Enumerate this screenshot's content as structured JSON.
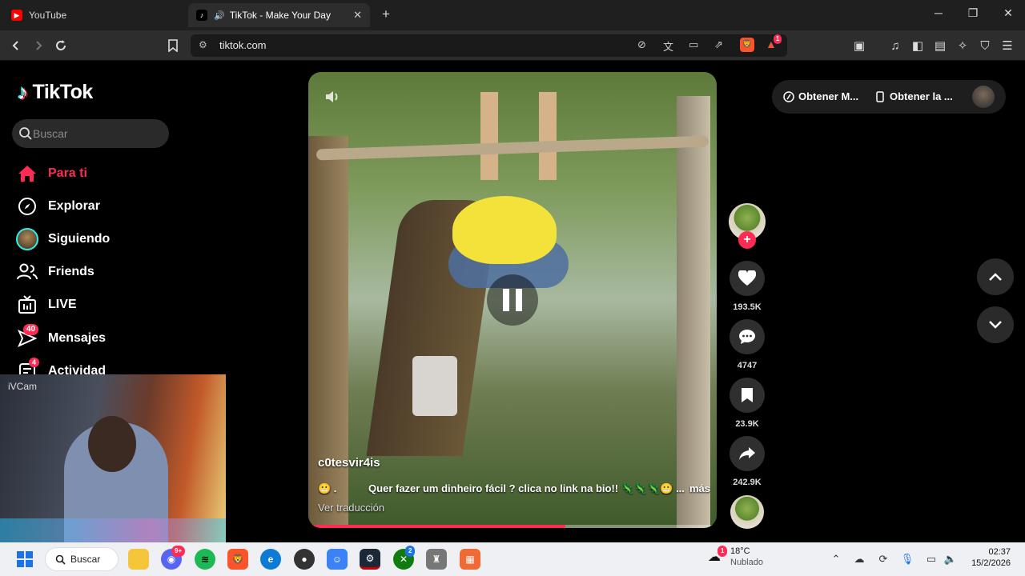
{
  "browser": {
    "tabs": [
      {
        "title": "YouTube",
        "active": false
      },
      {
        "title": "TikTok - Make Your Day",
        "active": true
      }
    ],
    "new_tab": "+",
    "url": "tiktok.com",
    "brave_badge": "1"
  },
  "sidebar": {
    "logo": "TikTok",
    "search_placeholder": "Buscar",
    "nav": [
      {
        "label": "Para ti",
        "icon": "home-icon",
        "active": true
      },
      {
        "label": "Explorar",
        "icon": "compass-icon"
      },
      {
        "label": "Siguiendo",
        "icon": "avatar-icon"
      },
      {
        "label": "Friends",
        "icon": "friends-icon"
      },
      {
        "label": "LIVE",
        "icon": "live-tv-icon"
      },
      {
        "label": "Mensajes",
        "icon": "send-icon",
        "badge": "40"
      },
      {
        "label": "Actividad",
        "icon": "activity-icon",
        "badge": "4"
      }
    ]
  },
  "webcam": {
    "label": "iVCam"
  },
  "video": {
    "author": "c0tesvir4is",
    "caption": "Quer fazer um dinheiro fácil ?  clica no link na bio!! 🦎🦎🦎😬 ...",
    "caption_prefix": "😬 .",
    "more": "más",
    "translate": "Ver traducción",
    "progress": 0.63
  },
  "actions": {
    "likes": "193.5K",
    "comments": "4747",
    "saves": "23.9K",
    "shares": "242.9K"
  },
  "top_pills": {
    "get_more": "Obtener M...",
    "get_app": "Obtener la ..."
  },
  "taskbar": {
    "search_label": "Buscar",
    "discord_badge": "9+",
    "xbox_badge": "2",
    "weather_temp": "18°C",
    "weather_desc": "Nublado",
    "weather_badge": "1",
    "time": "02:37",
    "date": "15/2/2026"
  },
  "colors": {
    "accent": "#fe2c55",
    "bg": "#000000",
    "progress_bg": "#ffffff"
  }
}
